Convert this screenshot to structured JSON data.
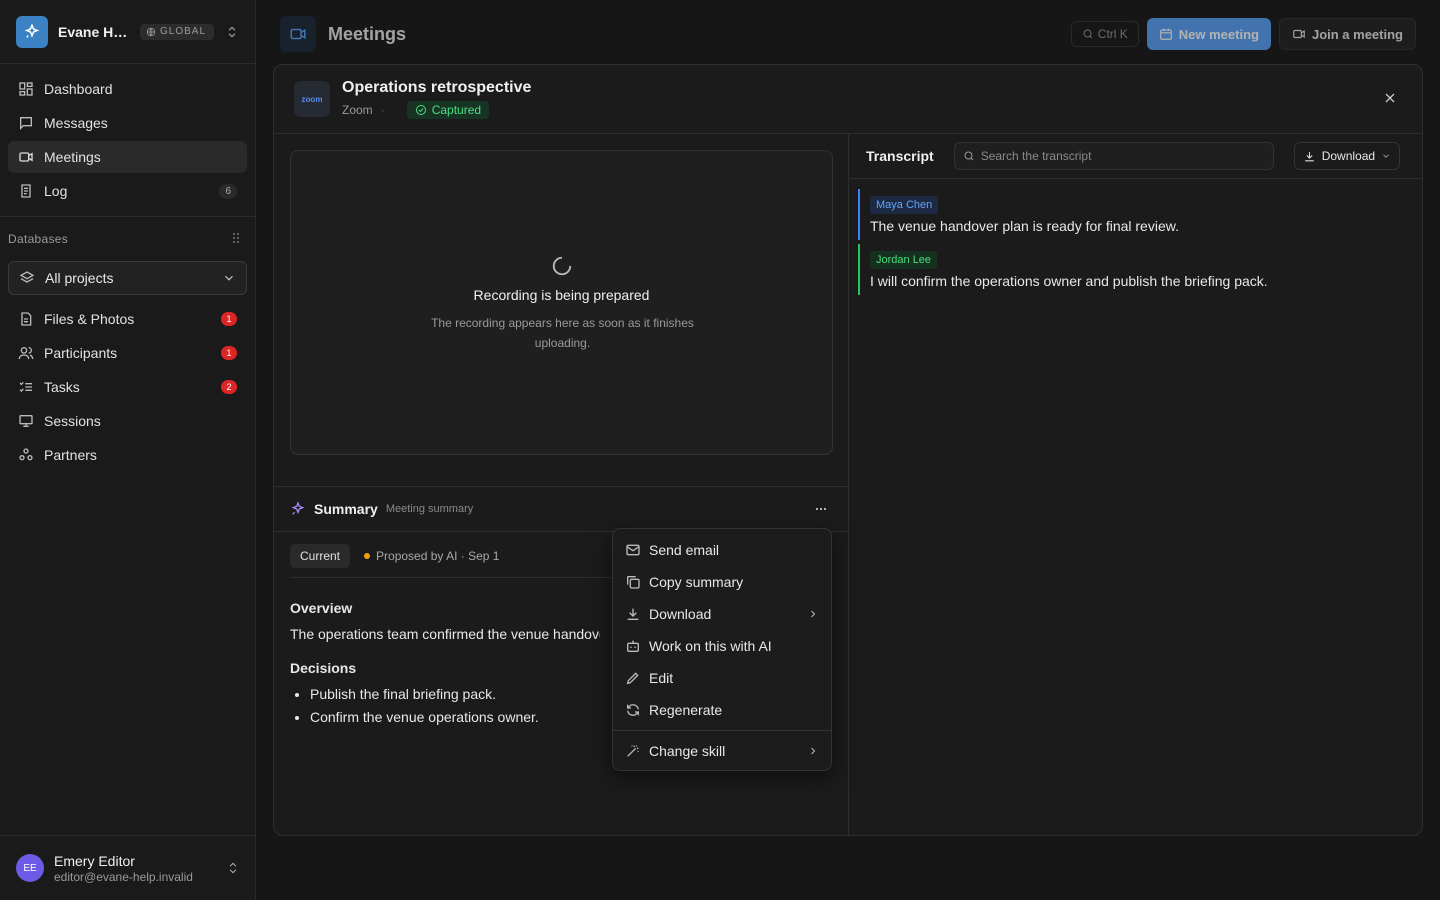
{
  "workspace": {
    "name": "Evane Help",
    "badge": "GLOBAL"
  },
  "nav": [
    {
      "label": "Dashboard",
      "icon": "dashboard-icon"
    },
    {
      "label": "Messages",
      "icon": "message-icon"
    },
    {
      "label": "Meetings",
      "icon": "video-icon",
      "active": true
    },
    {
      "label": "Log",
      "icon": "log-icon",
      "count": "6"
    }
  ],
  "databases": {
    "heading": "Databases",
    "project_select": "All projects",
    "items": [
      {
        "label": "Files & Photos",
        "count": "1"
      },
      {
        "label": "Participants",
        "count": "1"
      },
      {
        "label": "Tasks",
        "count": "2"
      },
      {
        "label": "Sessions"
      },
      {
        "label": "Partners"
      }
    ]
  },
  "user": {
    "initials": "EE",
    "name": "Emery Editor",
    "email": "editor@evane-help.invalid"
  },
  "topbar": {
    "title": "Meetings",
    "search_shortcut": "Ctrl K",
    "new_meeting": "New meeting",
    "join_meeting": "Join a meeting"
  },
  "modal": {
    "logo_text": "zoom",
    "title": "Operations retrospective",
    "platform": "Zoom",
    "separator": "·",
    "status": "Captured",
    "recording": {
      "title": "Recording is being prepared",
      "description": "The recording appears here as soon as it finishes uploading."
    },
    "summary": {
      "title": "Summary",
      "subtitle": "Meeting summary",
      "version_current": "Current",
      "version_ai": "Proposed by AI · Sep 1",
      "overview_heading": "Overview",
      "overview_text": "The operations team confirmed the venue handover plan.",
      "decisions_heading": "Decisions",
      "decisions": [
        "Publish the final briefing pack.",
        "Confirm the venue operations owner."
      ]
    },
    "transcript": {
      "title": "Transcript",
      "search_placeholder": "Search the transcript",
      "download_label": "Download",
      "utterances": [
        {
          "speaker": "Maya Chen",
          "text": "The venue handover plan is ready for final review.",
          "color": "#3b82f6"
        },
        {
          "speaker": "Jordan Lee",
          "text": "I will confirm the operations owner and publish the briefing pack.",
          "color": "#22c55e"
        }
      ]
    }
  },
  "menu": {
    "items": [
      {
        "label": "Send email",
        "icon": "mail-icon"
      },
      {
        "label": "Copy summary",
        "icon": "copy-icon"
      },
      {
        "label": "Download",
        "icon": "download-icon",
        "submenu": true
      },
      {
        "label": "Work on this with AI",
        "icon": "bot-icon"
      },
      {
        "label": "Edit",
        "icon": "pencil-icon"
      },
      {
        "label": "Regenerate",
        "icon": "refresh-icon"
      }
    ],
    "footer_item": {
      "label": "Change skill",
      "icon": "wand-icon",
      "submenu": true
    }
  }
}
